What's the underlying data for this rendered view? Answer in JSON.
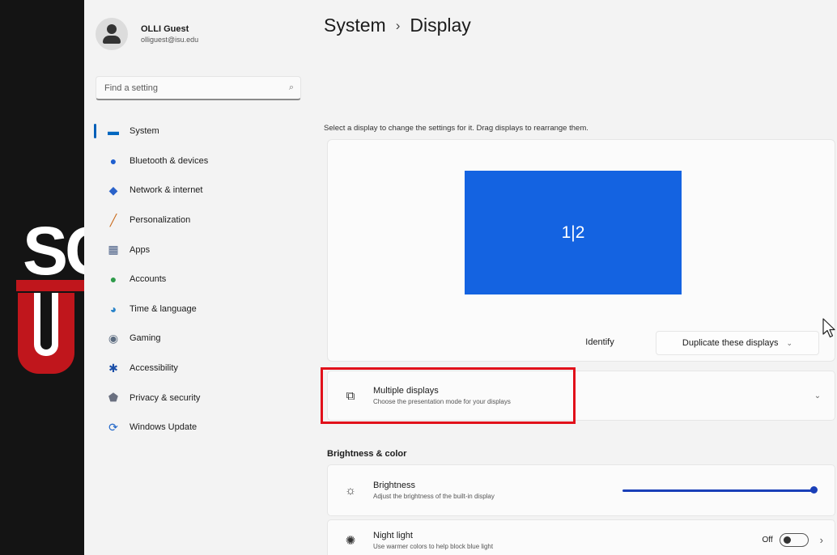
{
  "profile": {
    "name": "OLLI Guest",
    "email": "olliguest@isu.edu"
  },
  "search": {
    "placeholder": "Find a setting"
  },
  "icons": {
    "search": "search-icon",
    "cursor": "mouse-pointer-icon"
  },
  "nav": {
    "items": [
      {
        "label": "System",
        "icon": "system-icon",
        "glyph": "▬",
        "color": "#0067c0",
        "active": true
      },
      {
        "label": "Bluetooth & devices",
        "icon": "bluetooth-icon",
        "glyph": "●",
        "color": "#1f5fcf"
      },
      {
        "label": "Network & internet",
        "icon": "network-icon",
        "glyph": "◆",
        "color": "#2a62c9"
      },
      {
        "label": "Personalization",
        "icon": "personalization-brush-icon",
        "glyph": "╱",
        "color": "#c96a1a"
      },
      {
        "label": "Apps",
        "icon": "apps-icon",
        "glyph": "▦",
        "color": "#4a5f86"
      },
      {
        "label": "Accounts",
        "icon": "accounts-icon",
        "glyph": "●",
        "color": "#2e9b4a"
      },
      {
        "label": "Time & language",
        "icon": "time-language-icon",
        "glyph": "◕",
        "color": "#2a84c9"
      },
      {
        "label": "Gaming",
        "icon": "gaming-icon",
        "glyph": "◉",
        "color": "#5c6c80"
      },
      {
        "label": "Accessibility",
        "icon": "accessibility-icon",
        "glyph": "✱",
        "color": "#1b4fa8"
      },
      {
        "label": "Privacy & security",
        "icon": "privacy-shield-icon",
        "glyph": "⬟",
        "color": "#6a7080"
      },
      {
        "label": "Windows Update",
        "icon": "windows-update-icon",
        "glyph": "⟳",
        "color": "#1f65c8"
      }
    ]
  },
  "page": {
    "section": "System",
    "title": "Display",
    "arrange_hint": "Select a display to change the settings for it. Drag displays to rearrange them.",
    "display_label": "1|2",
    "identify_label": "Identify",
    "duplicate_label": "Duplicate these displays"
  },
  "multiple_displays": {
    "title": "Multiple displays",
    "desc": "Choose the presentation mode for your displays"
  },
  "brightness_color": {
    "heading": "Brightness & color",
    "brightness": {
      "title": "Brightness",
      "desc": "Adjust the brightness of the built-in display",
      "value_percent": 100
    },
    "night_light": {
      "title": "Night light",
      "desc": "Use warmer colors to help block blue light",
      "state": "Off"
    }
  },
  "colors": {
    "accent": "#005fb8",
    "display_tile": "#1463e1",
    "highlight_box": "#e1101a",
    "slider": "#1a3fb8"
  }
}
